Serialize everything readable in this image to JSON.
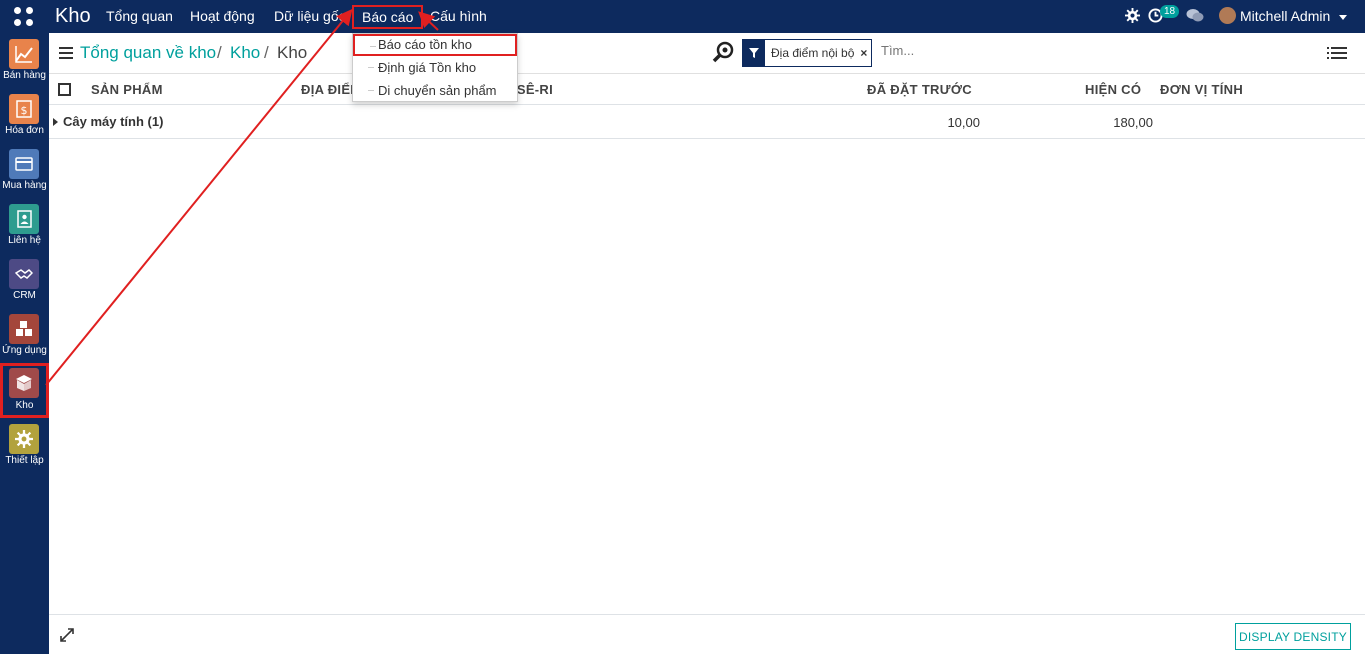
{
  "topbar": {
    "brand": "Kho",
    "menus": [
      "Tổng quan",
      "Hoạt động",
      "Dữ liệu gốc",
      "Báo cáo",
      "Cấu hình"
    ],
    "activity_count": "18",
    "user_name": "Mitchell Admin"
  },
  "sidebar": {
    "apps": [
      {
        "label": "Bán hàng",
        "color": "#e8834b"
      },
      {
        "label": "Hóa đơn",
        "color": "#e8834b"
      },
      {
        "label": "Mua hàng",
        "color": "#4f7ab9"
      },
      {
        "label": "Liên hệ",
        "color": "#2e9c8f"
      },
      {
        "label": "CRM",
        "color": "#4d4a85"
      },
      {
        "label": "Ứng dụng",
        "color": "#a4463b"
      },
      {
        "label": "Kho",
        "color": "#a04a4a"
      },
      {
        "label": "Thiết lập",
        "color": "#b2a23d"
      }
    ]
  },
  "control_panel": {
    "breadcrumb": [
      "Tổng quan về kho",
      "/",
      "Kho",
      "/",
      "Kho"
    ],
    "facet": "Địa điểm nội bộ",
    "search_placeholder": "Tìm..."
  },
  "dropdown": {
    "items": [
      "Báo cáo tồn kho",
      "Định giá Tồn kho",
      "Di chuyển sản phẩm"
    ]
  },
  "table": {
    "headers": [
      "SẢN PHẨM",
      "ĐỊA ĐIỂM",
      "SỐ LÔ/SÊ-RI",
      "ĐÃ ĐẶT TRƯỚC",
      "HIỆN CÓ",
      "ĐƠN VỊ TÍNH"
    ],
    "group": {
      "name": "Cây máy tính (1)",
      "reserved": "10,00",
      "on_hand": "180,00"
    }
  },
  "footer": {
    "density_label": "DISPLAY DENSITY"
  },
  "colors": {
    "navbar": "#0d2a5e",
    "accent": "#00a09d",
    "annotation": "#e02020"
  }
}
